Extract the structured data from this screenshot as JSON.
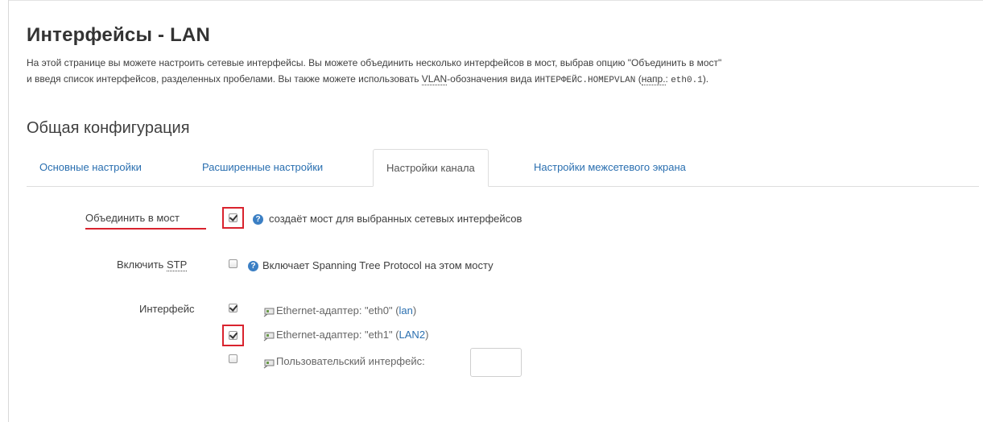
{
  "page": {
    "title": "Интерфейсы - LAN",
    "description_line1": "На этой странице вы можете настроить сетевые интерфейсы. Вы можете объединить несколько интерфейсов в мост, выбрав опцию \"Объединить в мост\"",
    "description_line2_a": "и введя список интерфейсов, разделенных пробелами. Вы также можете использовать ",
    "description_vlan": "VLAN",
    "description_line2_b": "-обозначения вида ",
    "description_code1": "ИНТЕРФЕЙС.НОМЕРVLAN",
    "description_line2_c": " (",
    "description_abbr": "напр.",
    "description_line2_d": ": ",
    "description_code2": "eth0.1",
    "description_line2_e": ")."
  },
  "section": {
    "title": "Общая конфигурация"
  },
  "tabs": [
    {
      "label": "Основные настройки",
      "active": false
    },
    {
      "label": "Расширенные настройки",
      "active": false
    },
    {
      "label": "Настройки канала",
      "active": true
    },
    {
      "label": "Настройки межсетевого экрана",
      "active": false
    }
  ],
  "fields": {
    "bridge": {
      "label": "Объединить в мост",
      "checked": true,
      "help": "создаёт мост для выбранных сетевых интерфейсов"
    },
    "stp": {
      "label": "Включить",
      "label_abbr": "STP",
      "checked": false,
      "help": "Включает Spanning Tree Protocol на этом мосту"
    },
    "interface": {
      "label": "Интерфейс",
      "items": [
        {
          "text": "Ethernet-адаптер: \"eth0\" (",
          "link": "lan",
          "suffix": ")",
          "checked": true
        },
        {
          "text": "Ethernet-адаптер: \"eth1\" (",
          "link": "LAN2",
          "suffix": ")",
          "checked": true
        },
        {
          "text": "Пользовательский интерфейс:",
          "link": "",
          "suffix": "",
          "checked": false
        }
      ],
      "custom_value": ""
    }
  },
  "colors": {
    "link": "#2a6fb0",
    "highlight": "#d9232e",
    "help_icon": "#3b7fc4"
  }
}
